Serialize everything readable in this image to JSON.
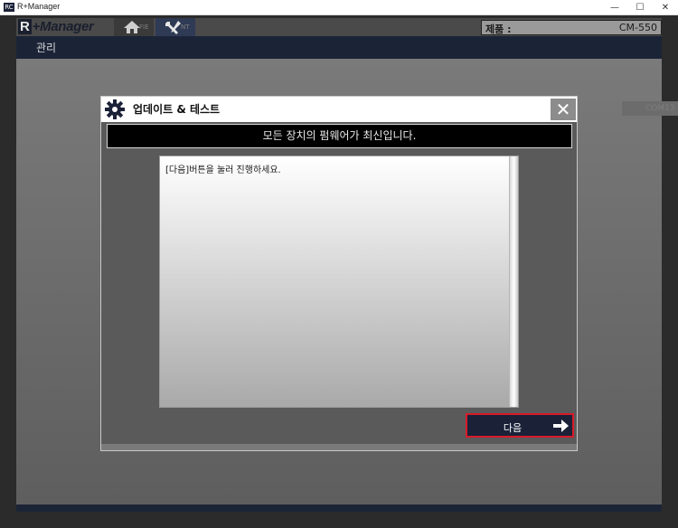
{
  "window": {
    "app_icon_text": "RC",
    "title": "R+Manager",
    "minimize_glyph": "—",
    "maximize_glyph": "☐",
    "close_glyph": "✕"
  },
  "header": {
    "logo_r": "R",
    "logo_text": "+Manager",
    "tabs": [
      {
        "icon": "home-icon",
        "faint_label": "FIE"
      },
      {
        "icon": "tools-icon",
        "faint_label": "NT"
      }
    ],
    "product_label": "제품 :",
    "product_value": "CM-550"
  },
  "subnav": {
    "label": "관리"
  },
  "com_badge": "COM13",
  "dialog": {
    "title": "업데이트 & 테스트",
    "close_glyph": "✕",
    "banner": "모든 장치의 펌웨어가 최신입니다.",
    "log_text": "[다음]버튼을 눌러 진행하세요.",
    "next_label": "다음"
  },
  "colors": {
    "navy": "#1b2437",
    "button_border": "#d81a2a"
  }
}
